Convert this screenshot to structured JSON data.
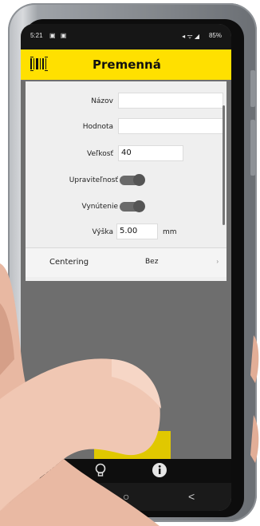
{
  "statusbar": {
    "time": "5:21",
    "left_icons": "▣ ▣",
    "right_icons": "◂ ᯤ ◢",
    "battery": "85%"
  },
  "header": {
    "title": "Premenná",
    "icon": "barcode-icon"
  },
  "form": {
    "name_label": "Názov",
    "name_value": "",
    "value_label": "Hodnota",
    "value_value": "",
    "size_label": "Veľkosť",
    "size_value": "40",
    "editable_label": "Upraviteľnosť",
    "forced_label": "Vynútenie",
    "height_label": "Výška",
    "height_value": "5.00",
    "height_unit": "mm",
    "centering_label": "Centering",
    "centering_value": "Bez"
  },
  "bottom_bar": {
    "icons": [
      "barcode-icon",
      "bulb-icon",
      "info-icon"
    ]
  },
  "nav_bar": {
    "recent": "|||",
    "home": "○",
    "back": "<"
  },
  "colors": {
    "accent": "#ffe000",
    "button": "#e0c800",
    "screen_bg": "#6e6e6e"
  }
}
